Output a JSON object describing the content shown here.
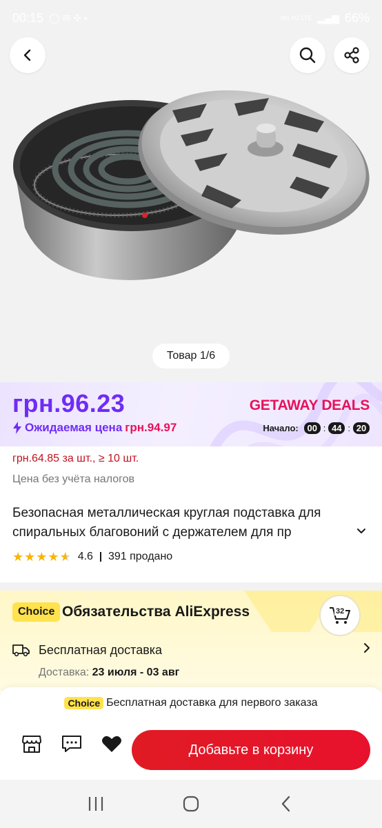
{
  "status_bar": {
    "time": "00:15",
    "battery": "66%",
    "network": "Vo) 4G LTE"
  },
  "gallery": {
    "counter": "Товар 1/6",
    "icons": [
      "back-icon",
      "search-icon",
      "share-icon"
    ]
  },
  "price": {
    "main": "грн.96.23",
    "expected_label": "Ожидаемая цена",
    "expected_value": "грн.94.97",
    "deals_label": "GETAWAY DEALS",
    "timer_label": "Начало:",
    "timer": [
      "00",
      "44",
      "20"
    ]
  },
  "product": {
    "bulk_price": "грн.64.85 за шт., ≥ 10 шт.",
    "tax_note": "Цена без учёта налогов",
    "title": "Безопасная металлическая круглая подставка для спиральных благовоний с держателем для пр",
    "rating": "4.6",
    "stars": 4.6,
    "sold": "391 продано"
  },
  "choice": {
    "badge": "Choice",
    "title": "Обязательства AliExpress",
    "cart_badge": "32",
    "delivery_title": "Бесплатная доставка",
    "delivery_label": "Доставка:",
    "delivery_dates": "23 июля - 03 авг"
  },
  "bottom_bar": {
    "choice_badge": "Choice",
    "promo_text": "Бесплатная доставка для первого заказа",
    "cart_button": "Добавьте в корзину"
  },
  "colors": {
    "accent": "#6f2cf5",
    "deals": "#e8115b",
    "cta": "#e01b24",
    "choice_yellow": "#ffe24d"
  }
}
